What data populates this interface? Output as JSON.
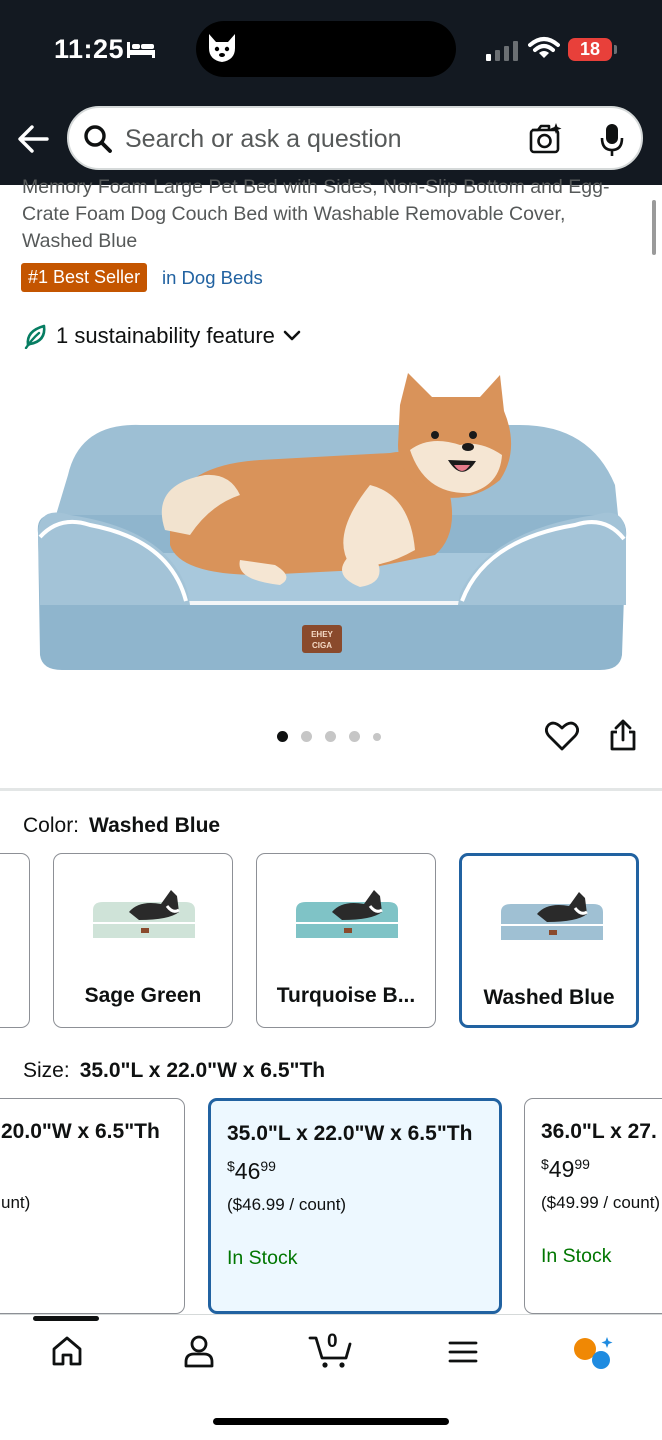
{
  "status_bar": {
    "time": "11:25",
    "battery": "18"
  },
  "search": {
    "placeholder": "Search or ask a question"
  },
  "product": {
    "title_text": "Memory Foam Large Pet Bed with Sides, Non-Slip Bottom and Egg-Crate Foam Dog Couch Bed with Washable Removable Cover, Washed Blue",
    "badge": "#1 Best Seller",
    "category_link": "in Dog Beds",
    "sustainability": "1 sustainability feature",
    "brand_tag": "EHEY CIGA",
    "image_dots": {
      "count": 5,
      "active": 1
    }
  },
  "color": {
    "label": "Color:",
    "selected": "Washed Blue",
    "options": [
      {
        "name": "Sage Green",
        "color": "#cfe3d8"
      },
      {
        "name": "Turquoise B...",
        "color": "#7fc3c6"
      },
      {
        "name": "Washed Blue",
        "color": "#9fc0d3"
      }
    ]
  },
  "size": {
    "label": "Size:",
    "selected": "35.0\"L x 22.0\"W x 6.5\"Th",
    "options": [
      {
        "title": "20.0\"W x 6.5\"Th",
        "unit": "unt)"
      },
      {
        "title": "35.0\"L x 22.0\"W x 6.5\"Th",
        "price_dollars": "46",
        "price_cents": "99",
        "unit": "($46.99 / count)",
        "stock": "In Stock"
      },
      {
        "title": "36.0\"L x 27.",
        "price_dollars": "49",
        "price_cents": "99",
        "unit": "($49.99 / count)",
        "stock": "In Stock"
      }
    ]
  },
  "bottom_nav": {
    "items": [
      "home-icon",
      "account-icon",
      "cart-icon",
      "menu-icon",
      "rufus-icon"
    ],
    "cart_count": "0"
  },
  "colors": {
    "header": "#131921",
    "link": "#2162a1",
    "badge": "#c45500",
    "stock": "#007600",
    "selected_border": "#2162a1"
  }
}
